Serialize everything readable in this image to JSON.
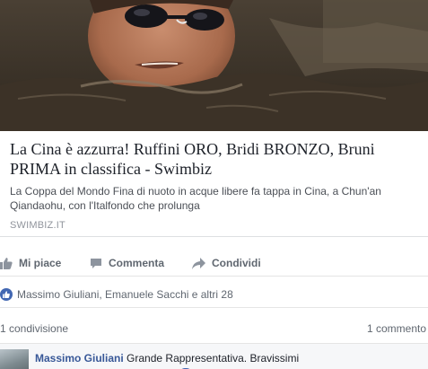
{
  "post": {
    "link": {
      "title": "La Cina è azzurra! Ruffini ORO, Bridi BRONZO, Bruni PRIMA in classifica - Swimbiz",
      "description": "La Coppa del Mondo Fina di nuoto in acque libere fa tappa in Cina, a Chun'an Qiandaohu, con l'Italfondo che prolunga",
      "domain": "SWIMBIZ.IT"
    },
    "actions": {
      "like_label": "Mi piace",
      "comment_label": "Commenta",
      "share_label": "Condividi"
    },
    "reactions": {
      "text": "Massimo Giuliani, Emanuele Sacchi e altri 28"
    },
    "counts": {
      "shares": "1 condivisione",
      "comments": "1 commento"
    },
    "comments": [
      {
        "author": "Massimo Giuliani",
        "text": "Grande Rappresentativa. Bravissimi"
      }
    ]
  }
}
